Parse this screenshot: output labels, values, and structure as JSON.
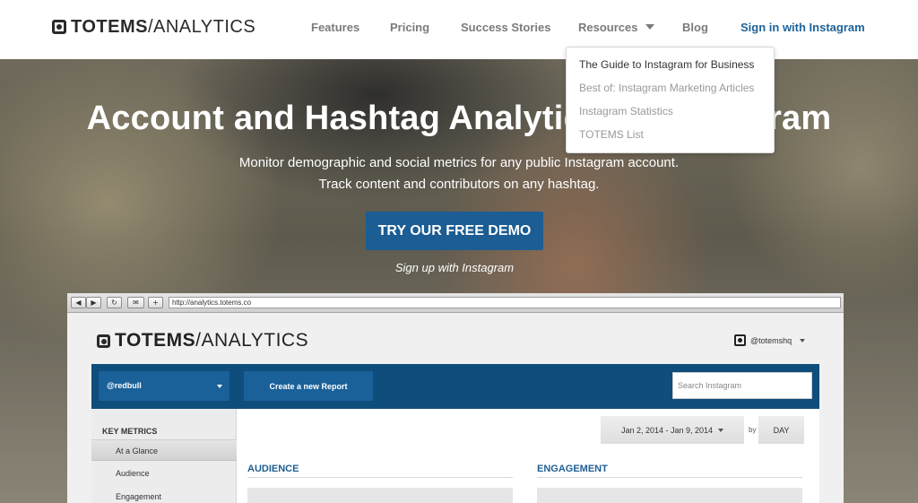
{
  "nav": {
    "logo_bold": "TOTEMS",
    "logo_light": "/ANALYTICS",
    "items": [
      {
        "label": "Features"
      },
      {
        "label": "Pricing"
      },
      {
        "label": "Success Stories"
      },
      {
        "label": "Resources"
      },
      {
        "label": "Blog"
      }
    ],
    "signin": "Sign in with Instagram"
  },
  "dropdown": {
    "items": [
      {
        "label": "The Guide to Instagram for Business"
      },
      {
        "label": "Best of: Instagram Marketing Articles"
      },
      {
        "label": "Instagram Statistics"
      },
      {
        "label": "TOTEMS List"
      }
    ]
  },
  "hero": {
    "title": "Account and Hashtag Analytics for Instagram",
    "subtitle_line1": "Monitor demographic and social metrics for any public Instagram account.",
    "subtitle_line2": "Track content and contributors on any hashtag.",
    "cta": "TRY OUR FREE DEMO",
    "signup": "Sign up with Instagram"
  },
  "browser": {
    "buttons": [
      "◀",
      "▶",
      "↻",
      "✉",
      "+"
    ],
    "url": "http://analytics.totems.co",
    "app_logo_bold": "TOTEMS",
    "app_logo_light": "/ANALYTICS",
    "user": "@totemshq",
    "account": "@redbull",
    "create_report": "Create a new Report",
    "search_placeholder": "Search Instagram",
    "sidebar_heading": "KEY METRICS",
    "sidebar_items": [
      {
        "label": "At a Glance"
      },
      {
        "label": "Audience"
      },
      {
        "label": "Engagement"
      }
    ],
    "date_range": "Jan 2, 2014 - Jan 9, 2014",
    "by": "by",
    "granularity": "DAY",
    "section_audience": "AUDIENCE",
    "section_engagement": "ENGAGEMENT"
  },
  "colors": {
    "accent_blue": "#1e6399",
    "cta_blue": "#1c5d93",
    "app_bar_blue": "#0f4d7d"
  }
}
